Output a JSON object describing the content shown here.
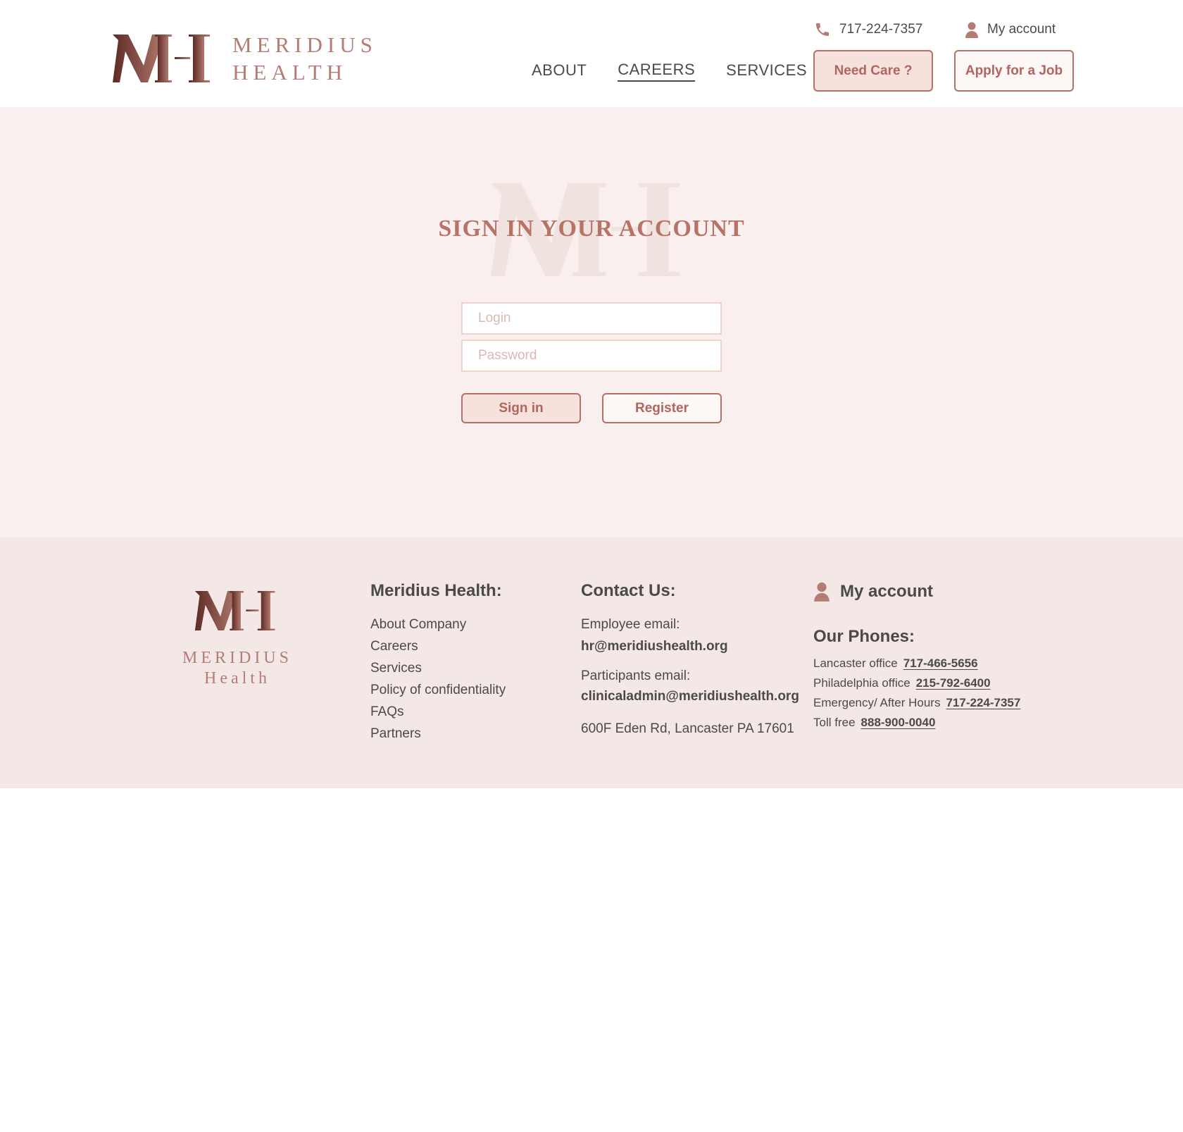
{
  "header": {
    "logo_line1": "MERIDIUS",
    "logo_line2": "HEALTH",
    "phone": "717-224-7357",
    "account": "My account",
    "nav": [
      {
        "label": "ABOUT"
      },
      {
        "label": "CAREERS",
        "active": true
      },
      {
        "label": "SERVICES"
      }
    ],
    "need_care": "Need Care ?",
    "apply_job": "Apply for a Job"
  },
  "signin": {
    "title": "SIGN IN YOUR ACCOUNT",
    "login_placeholder": "Login",
    "password_placeholder": "Password",
    "signin_label": "Sign in",
    "register_label": "Register"
  },
  "footer": {
    "logo_line1": "MERIDIUS",
    "logo_line2": "Health",
    "about_title": "Meridius Health:",
    "about_links": [
      "About Company",
      "Careers",
      "Services",
      "Policy of confidentiality",
      "FAQs",
      "Partners"
    ],
    "contact_title": "Contact Us:",
    "employee_label": "Employee email:",
    "employee_email": "hr@meridiushealth.org",
    "participants_label": "Participants email:",
    "participants_email": "clinicaladmin@meridiushealth.org",
    "address": "600F Eden Rd, Lancaster PA 17601",
    "account_title": "My account",
    "phones_title": "Our Phones:",
    "phones": [
      {
        "label": "Lancaster office",
        "number": "717-466-5656"
      },
      {
        "label": "Philadelphia office",
        "number": "215-792-6400"
      },
      {
        "label": "Emergency/ After Hours",
        "number": "717-224-7357"
      },
      {
        "label": "Toll free",
        "number": "888-900-0040"
      }
    ]
  },
  "colors": {
    "brand": "#b0665e",
    "brand_dark": "#6e3a33",
    "signin_bg": "#f8efee",
    "footer_bg": "#f4e8e7",
    "button_fill": "#f6e1dd"
  },
  "icons": [
    "phone-icon",
    "user-icon"
  ]
}
